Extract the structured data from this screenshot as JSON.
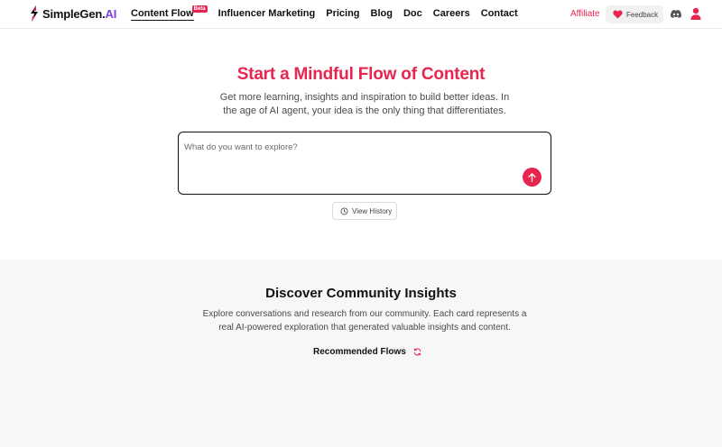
{
  "brand": {
    "name": "SimpleGen.",
    "suffix": "AI"
  },
  "nav": {
    "items": [
      {
        "label": "Content Flow",
        "badge": "Beta",
        "active": true
      },
      {
        "label": "Influencer Marketing"
      },
      {
        "label": "Pricing"
      },
      {
        "label": "Blog"
      },
      {
        "label": "Doc"
      },
      {
        "label": "Careers"
      },
      {
        "label": "Contact"
      }
    ],
    "affiliate": "Affiliate",
    "feedback": "Feedback",
    "icons": [
      "heart-icon",
      "discord-icon",
      "user-icon"
    ]
  },
  "hero": {
    "title": "Start a Mindful Flow of Content",
    "subtitle": "Get more learning, insights and inspiration to build better ideas. In the age of AI agent, your idea is the only thing that differentiates.",
    "input_placeholder": "What do you want to explore?",
    "input_value": "",
    "history_label": "View History"
  },
  "community": {
    "title": "Discover Community Insights",
    "subtitle": "Explore conversations and research from our community. Each card represents a real AI-powered exploration that generated valuable insights and content.",
    "recommended_label": "Recommended Flows"
  },
  "colors": {
    "accent": "#e8254f",
    "brand_ai": "#7b3fe4",
    "section_bg": "#f7f7f7"
  }
}
